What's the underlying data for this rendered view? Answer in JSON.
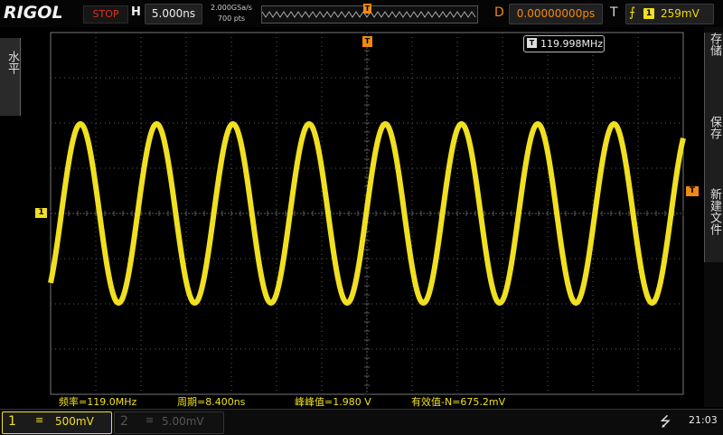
{
  "header": {
    "brand": "RIGOL",
    "run_status": "STOP",
    "timebase_letter": "H",
    "timebase": "5.000ns",
    "sample_rate": "2.000GSa/s",
    "memory_depth": "700 pts",
    "delay_letter": "D",
    "trigger_delay": "0.00000000ps",
    "trigger_letter": "T",
    "trigger_source": "1",
    "trigger_level": "259mV",
    "trigger_position_marker": "T"
  },
  "left_tab": {
    "label": "水平"
  },
  "right_tabs": [
    {
      "label": "存储"
    },
    {
      "label": "保存"
    },
    {
      "label": "新建文件"
    }
  ],
  "screen": {
    "frequency_counter_icon": "T",
    "frequency_counter": "119.998MHz",
    "ch1_marker": "1",
    "trigger_level_marker": "T",
    "trigger_position_marker": "T",
    "waveform": {
      "color": "#f0e020",
      "cycles_visible": 8.3,
      "visible_amplitude_divisions": 3.96
    }
  },
  "measurements": [
    {
      "label": "频率=119.0MHz"
    },
    {
      "label": "周期=8.400ns"
    },
    {
      "label": "峰峰值=1.980 V"
    },
    {
      "label": "有效值-N=675.2mV"
    }
  ],
  "footer": {
    "ch1": {
      "number": "1",
      "coupling": "≡",
      "scale": "500mV"
    },
    "ch2": {
      "number": "2",
      "coupling": "≡",
      "scale": "5.00mV"
    },
    "usb_icon": "usb-icon",
    "time": "21:03"
  },
  "colors": {
    "ch1": "#f0e020",
    "trigger": "#f08a10",
    "stop": "#e03020",
    "grid": "#5a5a5a"
  }
}
